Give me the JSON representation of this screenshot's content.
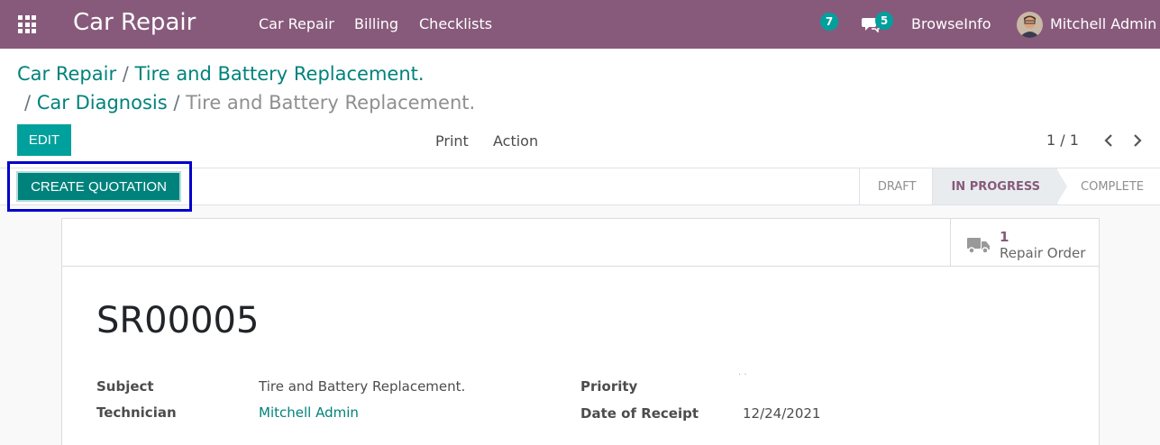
{
  "navbar": {
    "app_name": "Car Repair",
    "menu": [
      "Car Repair",
      "Billing",
      "Checklists"
    ],
    "activity_count": "7",
    "message_count": "5",
    "company": "BrowseInfo",
    "user": "Mitchell Admin",
    "bg_color": "#875a7b"
  },
  "breadcrumb": {
    "items": [
      "Car Repair",
      "Tire and Battery Replacement.",
      "Car Diagnosis"
    ],
    "active": "Tire and Battery Replacement.",
    "separator": "/"
  },
  "toolbar": {
    "edit_label": "EDIT",
    "print_label": "Print",
    "action_label": "Action",
    "pager": "1 / 1"
  },
  "statusbar": {
    "create_quotation_label": "CREATE QUOTATION",
    "stages": [
      "DRAFT",
      "IN PROGRESS",
      "COMPLETE"
    ],
    "current_stage": "IN PROGRESS"
  },
  "smart_button": {
    "count": "1",
    "label": "Repair Order",
    "icon": "truck-icon"
  },
  "record": {
    "name": "SR00005",
    "fields": {
      "subject_label": "Subject",
      "subject_value": "Tire and Battery Replacement.",
      "technician_label": "Technician",
      "technician_value": "Mitchell Admin",
      "priority_label": "Priority",
      "receipt_label": "Date of Receipt",
      "receipt_value": "12/24/2021"
    }
  },
  "colors": {
    "primary": "#00a09d",
    "brand": "#875a7b",
    "link": "#00827c",
    "highlight_box": "#0000cc"
  }
}
